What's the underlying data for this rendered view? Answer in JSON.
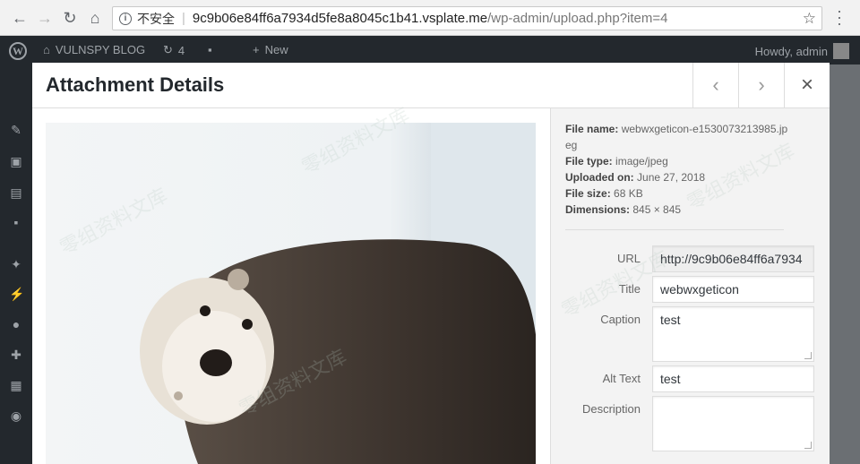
{
  "browser": {
    "insecure_label": "不安全",
    "url_host": "9c9b06e84ff6a7934d5fe8a8045c1b41.vsplate.me",
    "url_path": "/wp-admin/upload.php?item=4"
  },
  "adminbar": {
    "site_name": "VULNSPY BLOG",
    "updates_count": "4",
    "new_label": "New",
    "howdy": "Howdy, admin"
  },
  "modal": {
    "title": "Attachment Details",
    "prev_icon": "‹",
    "next_icon": "›",
    "close_icon": "×"
  },
  "file": {
    "name_label": "File name:",
    "name_value": "webwxgeticon-e1530073213985.jpeg",
    "type_label": "File type:",
    "type_value": "image/jpeg",
    "uploaded_label": "Uploaded on:",
    "uploaded_value": "June 27, 2018",
    "size_label": "File size:",
    "size_value": "68 KB",
    "dimensions_label": "Dimensions:",
    "dimensions_value": "845 × 845"
  },
  "fields": {
    "url_label": "URL",
    "url_value": "http://9c9b06e84ff6a7934",
    "title_label": "Title",
    "title_value": "webwxgeticon",
    "caption_label": "Caption",
    "caption_value": "test",
    "alt_label": "Alt Text",
    "alt_value": "test",
    "description_label": "Description",
    "description_value": ""
  },
  "watermark_text": "零组资料文库",
  "colors": {
    "adminbar": "#23282d",
    "accent": "#0073aa"
  }
}
